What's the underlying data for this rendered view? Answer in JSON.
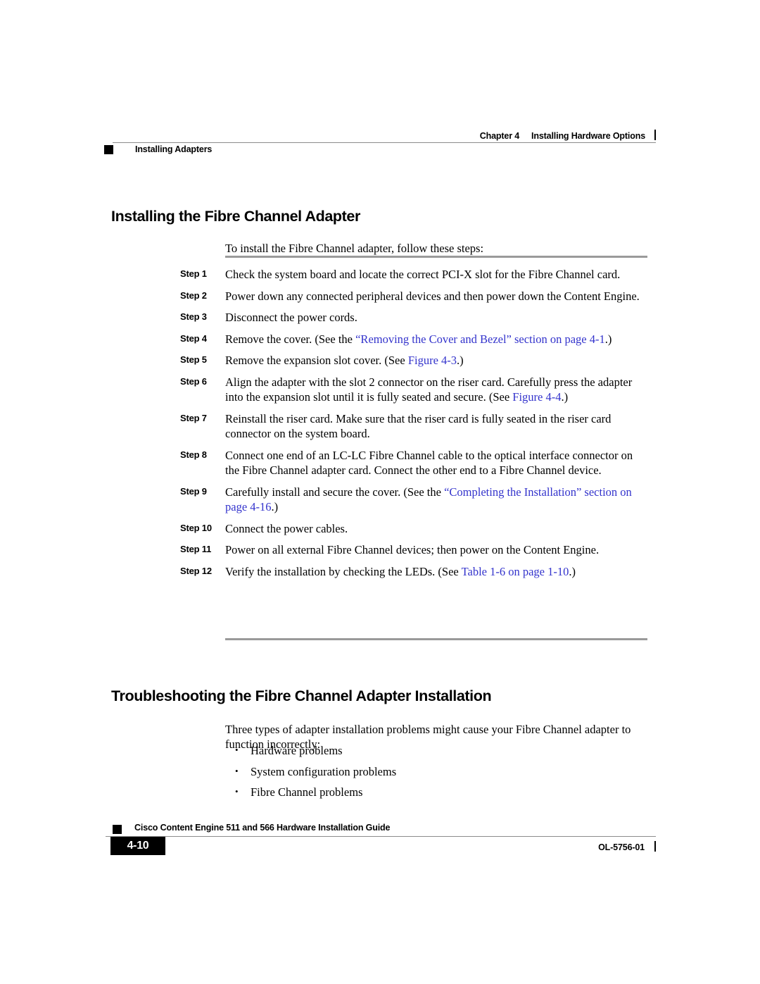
{
  "header": {
    "chapter": "Chapter 4",
    "chapter_title": "Installing Hardware Options",
    "running_title": "Installing Adapters"
  },
  "sections": {
    "installing": {
      "heading": "Installing the Fibre Channel Adapter",
      "intro": "To install the Fibre Channel adapter, follow these steps:"
    },
    "troubleshooting": {
      "heading": "Troubleshooting the Fibre Channel Adapter Installation",
      "intro": "Three types of adapter installation problems might cause your Fibre Channel adapter to function incorrectly:",
      "bullets": [
        "Hardware problems",
        "System configuration problems",
        "Fibre Channel problems"
      ]
    }
  },
  "steps": [
    {
      "label": "Step 1",
      "text_parts": [
        {
          "text": "Check the system board and locate the correct PCI-X slot for the Fibre Channel card.",
          "link": false
        }
      ]
    },
    {
      "label": "Step 2",
      "text_parts": [
        {
          "text": "Power down any connected peripheral devices and then power down the Content Engine.",
          "link": false
        }
      ]
    },
    {
      "label": "Step 3",
      "text_parts": [
        {
          "text": "Disconnect the power cords.",
          "link": false
        }
      ]
    },
    {
      "label": "Step 4",
      "text_parts": [
        {
          "text": "Remove the cover. (See the ",
          "link": false
        },
        {
          "text": "“Removing the Cover and Bezel” section on page 4-1",
          "link": true
        },
        {
          "text": ".)",
          "link": false
        }
      ]
    },
    {
      "label": "Step 5",
      "text_parts": [
        {
          "text": "Remove the expansion slot cover. (See ",
          "link": false
        },
        {
          "text": "Figure 4-3",
          "link": true
        },
        {
          "text": ".)",
          "link": false
        }
      ]
    },
    {
      "label": "Step 6",
      "text_parts": [
        {
          "text": "Align the adapter with the slot 2 connector on the riser card. Carefully press the adapter into the expansion slot until it is fully seated and secure. (See ",
          "link": false
        },
        {
          "text": "Figure 4-4",
          "link": true
        },
        {
          "text": ".)",
          "link": false
        }
      ]
    },
    {
      "label": "Step 7",
      "text_parts": [
        {
          "text": "Reinstall the riser card. Make sure that the riser card is fully seated in the riser card connector on the system board.",
          "link": false
        }
      ]
    },
    {
      "label": "Step 8",
      "text_parts": [
        {
          "text": "Connect one end of an LC-LC Fibre Channel cable to the optical interface connector on the Fibre Channel adapter card. Connect the other end to a Fibre Channel device.",
          "link": false
        }
      ]
    },
    {
      "label": "Step 9",
      "text_parts": [
        {
          "text": "Carefully install and secure the cover. (See the ",
          "link": false
        },
        {
          "text": "“Completing the Installation” section on page 4-16",
          "link": true
        },
        {
          "text": ".)",
          "link": false
        }
      ]
    },
    {
      "label": "Step 10",
      "text_parts": [
        {
          "text": "Connect the power cables.",
          "link": false
        }
      ]
    },
    {
      "label": "Step 11",
      "text_parts": [
        {
          "text": "Power on all external Fibre Channel devices; then power on the Content Engine.",
          "link": false
        }
      ]
    },
    {
      "label": "Step 12",
      "text_parts": [
        {
          "text": "Verify the installation by checking the LEDs. (See ",
          "link": false
        },
        {
          "text": "Table 1-6 on page 1-10",
          "link": true
        },
        {
          "text": ".)",
          "link": false
        }
      ]
    }
  ],
  "footer": {
    "guide_title": "Cisco Content Engine 511 and 566 Hardware Installation Guide",
    "page_number": "4-10",
    "document_id": "OL-5756-01"
  },
  "colors": {
    "link": "#3333cc",
    "rule_gray": "#9a9a9a",
    "hairline_gray": "#8c8c8c",
    "text": "#000000"
  }
}
